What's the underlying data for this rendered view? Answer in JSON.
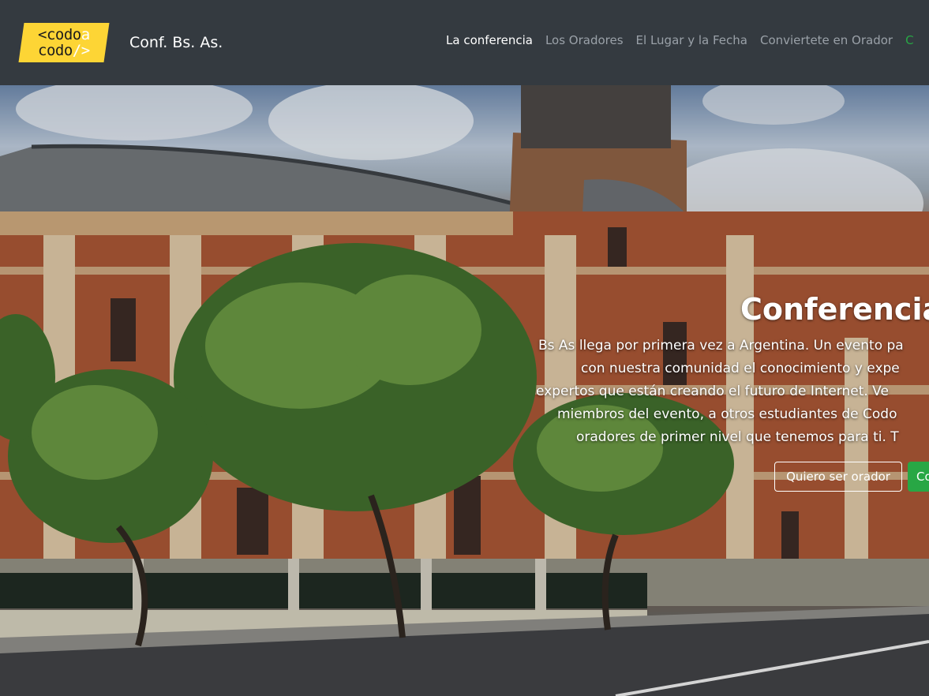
{
  "navbar": {
    "logo": {
      "line1": "<codo",
      "line1_accent": "a",
      "line2": "codo",
      "line2_accent": "/>"
    },
    "brand": "Conf. Bs. As.",
    "links": [
      {
        "label": "La conferencia",
        "active": true
      },
      {
        "label": "Los Oradores",
        "active": false
      },
      {
        "label": "El Lugar y la Fecha",
        "active": false
      },
      {
        "label": "Conviertete en Orador",
        "active": false
      },
      {
        "label": "C",
        "active": false
      }
    ]
  },
  "hero": {
    "title": "Conferencia",
    "lines": [
      "Bs As llega por primera vez a Argentina. Un evento pa",
      "con nuestra comunidad el conocimiento y expe",
      "expertos que están creando el futuro de Internet. Ve",
      "miembros del evento, a otros estudiantes de Codo",
      "oradores de primer nivel que tenemos para ti. T"
    ],
    "buttons": {
      "outline": "Quiero ser orador",
      "green": "Co"
    }
  },
  "colors": {
    "navbar_bg": "#343a40",
    "logo_yellow": "#fdd535",
    "accent_green": "#28a745"
  }
}
